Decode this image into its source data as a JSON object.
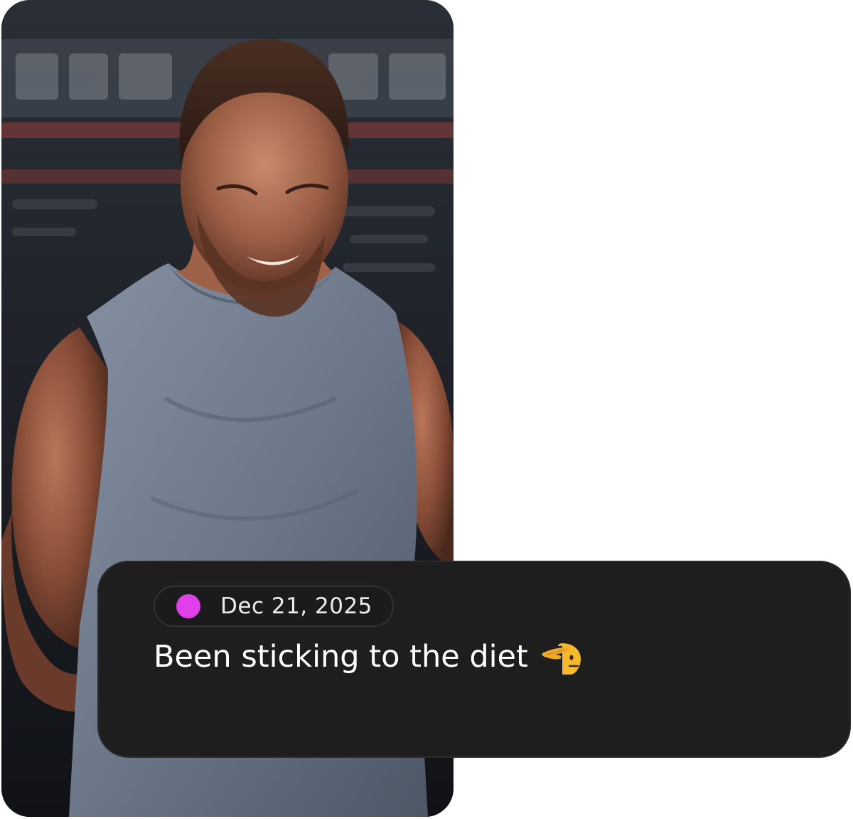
{
  "photo": {
    "subject": "man-in-sleeveless-tank-flexing"
  },
  "message_card": {
    "date": "Dec 21, 2025",
    "status_dot_color": "#e040ea",
    "message": "Been sticking to the diet",
    "emoji_icon": "saluting-face-icon"
  }
}
